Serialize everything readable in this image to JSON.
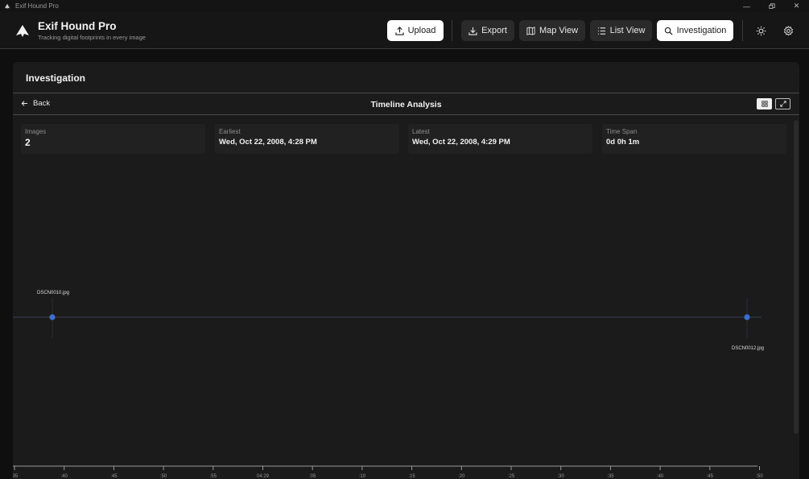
{
  "window": {
    "title": "Exif Hound Pro"
  },
  "header": {
    "app_name": "Exif Hound Pro",
    "tagline": "Tracking digital footprints in every image",
    "buttons": {
      "upload": "Upload",
      "export": "Export",
      "map_view": "Map View",
      "list_view": "List View",
      "investigation": "Investigation"
    }
  },
  "panel": {
    "title": "Investigation",
    "back_label": "Back",
    "subtitle": "Timeline Analysis"
  },
  "stats": [
    {
      "label": "Images",
      "value": "2"
    },
    {
      "label": "Earliest",
      "value": "Wed, Oct 22, 2008, 4:28 PM"
    },
    {
      "label": "Latest",
      "value": "Wed, Oct 22, 2008, 4:29 PM"
    },
    {
      "label": "Time Span",
      "value": "0d 0h 1m"
    }
  ],
  "timeline": {
    "events": [
      {
        "file": "DSCN0010.jpg",
        "label_side": "above"
      },
      {
        "file": "DSCN0012.jpg",
        "label_side": "below"
      }
    ],
    "ticks": [
      ":35",
      ":40",
      ":45",
      ":50",
      ":55",
      "04:29",
      ":05",
      ":10",
      ":15",
      ":20",
      ":25",
      ":30",
      ":35",
      ":40",
      ":45",
      ":50"
    ]
  },
  "colors": {
    "accent_point": "#3b6fd1",
    "background": "#1b1b1c"
  }
}
